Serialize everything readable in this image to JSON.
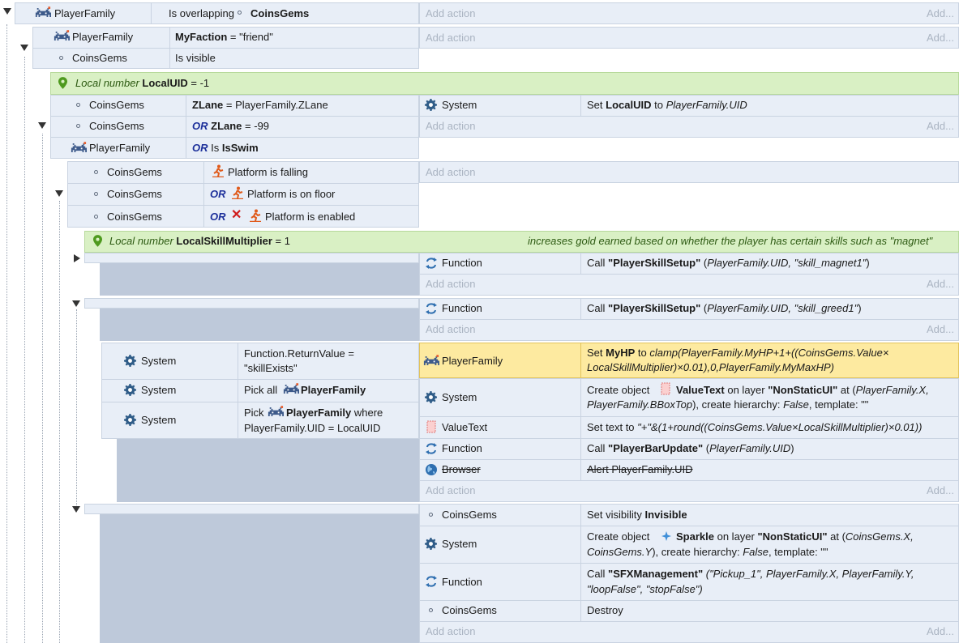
{
  "ev1": {
    "cond_obj": "PlayerFamily",
    "cond": "Is overlapping",
    "cond_target": "CoinsGems",
    "add_action": "Add action",
    "add": "Add..."
  },
  "ev2": {
    "c1_obj": "PlayerFamily",
    "c1_var": "MyFaction",
    "c1_rest": " = \"friend\"",
    "c2_obj": "CoinsGems",
    "c2": "Is visible",
    "add_action": "Add action",
    "add": "Add..."
  },
  "lv1": {
    "prefix": "Local number",
    "name": "LocalUID",
    "rest": " = -1"
  },
  "ev3": {
    "c1_obj": "CoinsGems",
    "c1_var": "ZLane",
    "c1_rest": " = PlayerFamily.ZLane",
    "c2_obj": "CoinsGems",
    "or": "OR",
    "c2_var": "ZLane",
    "c2_rest": " = -99",
    "c3_obj": "PlayerFamily",
    "c3_is": "Is",
    "c3_var": "IsSwim",
    "a1_obj": "System",
    "a1_pre": "Set",
    "a1_var": "LocalUID",
    "a1_mid": "to",
    "a1_val": "PlayerFamily.UID",
    "add_action": "Add action",
    "add": "Add..."
  },
  "ev4": {
    "c1_obj": "CoinsGems",
    "c1": "Platform is falling",
    "c2_obj": "CoinsGems",
    "c2": "Platform is on floor",
    "c3_obj": "CoinsGems",
    "c3": "Platform is enabled",
    "or": "OR",
    "add_action": "Add action"
  },
  "lv2": {
    "prefix": "Local number",
    "name": "LocalSkillMultiplier",
    "rest": " = 1",
    "comment": "increases gold earned based on whether the player has certain skills such as \"magnet\""
  },
  "ev5": {
    "a_obj": "Function",
    "a_pre": "Call",
    "a_name": "\"PlayerSkillSetup\"",
    "a_args": "PlayerFamily.UID, \"skill_magnet1\"",
    "add_action": "Add action",
    "add": "Add..."
  },
  "ev6": {
    "a_obj": "Function",
    "a_pre": "Call",
    "a_name": "\"PlayerSkillSetup\"",
    "a_args": "PlayerFamily.UID, \"skill_greed1\"",
    "add_action": "Add action",
    "add": "Add..."
  },
  "ev7": {
    "c1_obj": "System",
    "c1_l1": "Function.ReturnValue =",
    "c1_l2": "\"skillExists\"",
    "c2_obj": "System",
    "c2_pre": "Pick all",
    "c2_name": "PlayerFamily",
    "c3_obj": "System",
    "c3_pre": "Pick",
    "c3_name": "PlayerFamily",
    "c3_post": "where",
    "c3_l2": "PlayerFamily.UID = LocalUID",
    "a1_obj": "PlayerFamily",
    "a1_pre": "Set",
    "a1_var": "MyHP",
    "a1_to": "to",
    "a1_val1": "clamp(PlayerFamily.MyHP+1+((CoinsGems.Value×",
    "a1_val2": "LocalSkillMultiplier)×0.01),0,PlayerFamily.MyMaxHP)",
    "a2_obj": "System",
    "a2_pre": "Create object",
    "a2_name": "ValueText",
    "a2_on": "on layer",
    "a2_layer": "\"NonStaticUI\"",
    "a2_at": "at (",
    "a2_x": "PlayerFamily.X,",
    "a2_y": "PlayerFamily.BBoxTop",
    "a2_rest": "), create hierarchy:",
    "a2_h": "False",
    "a2_tpl": ", template: \"\"",
    "a3_obj": "ValueText",
    "a3_pre": "Set text to",
    "a3_val": "\"+\"&(1+round((CoinsGems.Value×LocalSkillMultiplier)×0.01))",
    "a4_obj": "Function",
    "a4_pre": "Call",
    "a4_name": "\"PlayerBarUpdate\"",
    "a4_args": "PlayerFamily.UID",
    "a5_obj": "Browser",
    "a5": "Alert PlayerFamily.UID",
    "add_action": "Add action",
    "add": "Add..."
  },
  "ev8": {
    "a1_obj": "CoinsGems",
    "a1_pre": "Set visibility",
    "a1_val": "Invisible",
    "a2_obj": "System",
    "a2_pre": "Create object",
    "a2_name": "Sparkle",
    "a2_on": "on layer",
    "a2_layer": "\"NonStaticUI\"",
    "a2_at": "at (",
    "a2_x": "CoinsGems.X,",
    "a2_y": "CoinsGems.Y",
    "a2_rest": "), create hierarchy:",
    "a2_h": "False",
    "a2_tpl": ", template: \"\"",
    "a3_obj": "Function",
    "a3_pre": "Call",
    "a3_name": "\"SFXManagement\"",
    "a3_args1": "(\"Pickup_1\", PlayerFamily.X, PlayerFamily.Y,",
    "a3_args2": "\"loopFalse\", \"stopFalse\")",
    "a4_obj": "CoinsGems",
    "a4": "Destroy",
    "add_action": "Add action",
    "add": "Add..."
  },
  "colors": {
    "block": "#e8eef7",
    "border": "#c9d3e1",
    "dark": "#bec9da",
    "variable": "#d9f0c4",
    "highlight": "#fdeaa0",
    "or": "#1c2f9a"
  }
}
